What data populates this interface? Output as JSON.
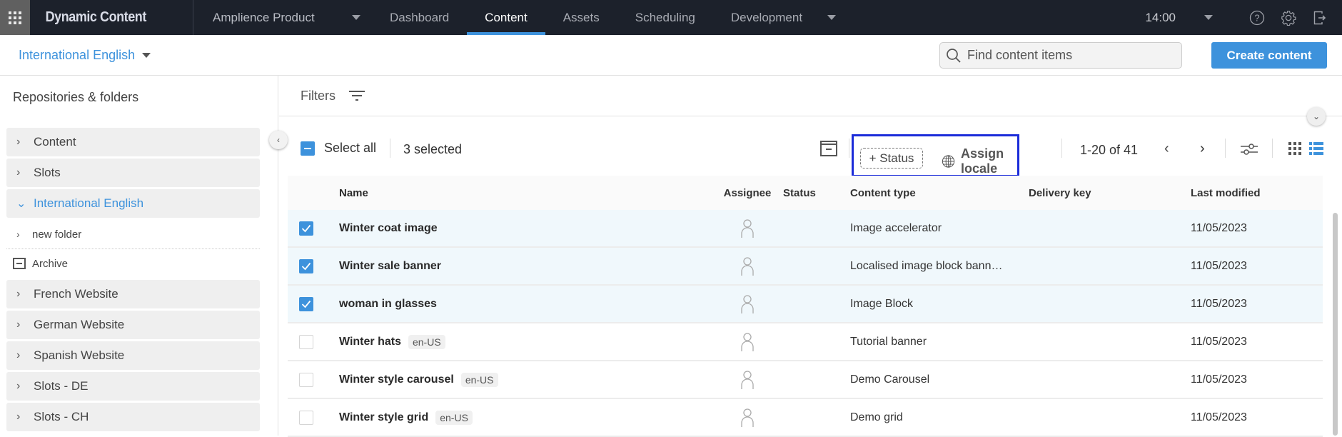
{
  "app": {
    "brand": "Dynamic Content",
    "hub": "Amplience Product",
    "nav": [
      {
        "label": "Dashboard",
        "active": false
      },
      {
        "label": "Content",
        "active": true
      },
      {
        "label": "Assets",
        "active": false
      },
      {
        "label": "Scheduling",
        "active": false
      },
      {
        "label": "Development",
        "active": false
      }
    ],
    "clock": "14:00",
    "icons": [
      "apps-grid-icon",
      "help-icon",
      "settings-gear-icon",
      "logout-icon"
    ]
  },
  "subbar": {
    "locale": "International English",
    "search_placeholder": "Find content items",
    "create_label": "Create content"
  },
  "sidebar": {
    "title": "Repositories & folders",
    "items": [
      {
        "label": "Content"
      },
      {
        "label": "Slots"
      },
      {
        "label": "International English",
        "expanded": true
      },
      {
        "label": "new folder",
        "sub": true
      },
      {
        "label": "Archive",
        "archive": true
      },
      {
        "label": "French Website"
      },
      {
        "label": "German Website"
      },
      {
        "label": "Spanish Website"
      },
      {
        "label": "Slots - DE"
      },
      {
        "label": "Slots - CH"
      }
    ]
  },
  "main": {
    "filters_label": "Filters",
    "select_all_label": "Select all",
    "selected_count": "3 selected",
    "status_button": "+ Status",
    "assign_locale": "Assign locale",
    "pagination": "1-20 of 41",
    "columns": [
      "Name",
      "Assignee",
      "Status",
      "Content type",
      "Delivery key",
      "Last modified"
    ],
    "rows": [
      {
        "checked": true,
        "name": "Winter coat image",
        "locale": "",
        "status": "",
        "type": "Image accelerator",
        "key": "",
        "modified": "11/05/2023"
      },
      {
        "checked": true,
        "name": "Winter sale banner",
        "locale": "",
        "status": "",
        "type": "Localised image block bann…",
        "key": "",
        "modified": "11/05/2023"
      },
      {
        "checked": true,
        "name": "woman in glasses",
        "locale": "",
        "status": "",
        "type": "Image Block",
        "key": "",
        "modified": "11/05/2023"
      },
      {
        "checked": false,
        "name": "Winter hats",
        "locale": "en-US",
        "status": "",
        "type": "Tutorial banner",
        "key": "",
        "modified": "11/05/2023"
      },
      {
        "checked": false,
        "name": "Winter style carousel",
        "locale": "en-US",
        "status": "",
        "type": "Demo Carousel",
        "key": "",
        "modified": "11/05/2023"
      },
      {
        "checked": false,
        "name": "Winter style grid",
        "locale": "en-US",
        "status": "",
        "type": "Demo grid",
        "key": "",
        "modified": "11/05/2023"
      }
    ]
  },
  "colors": {
    "accent": "#3d92dc",
    "topbar": "#1c212b",
    "highlight_box": "#1b2cd9",
    "selected_row": "#f0f8fc"
  }
}
